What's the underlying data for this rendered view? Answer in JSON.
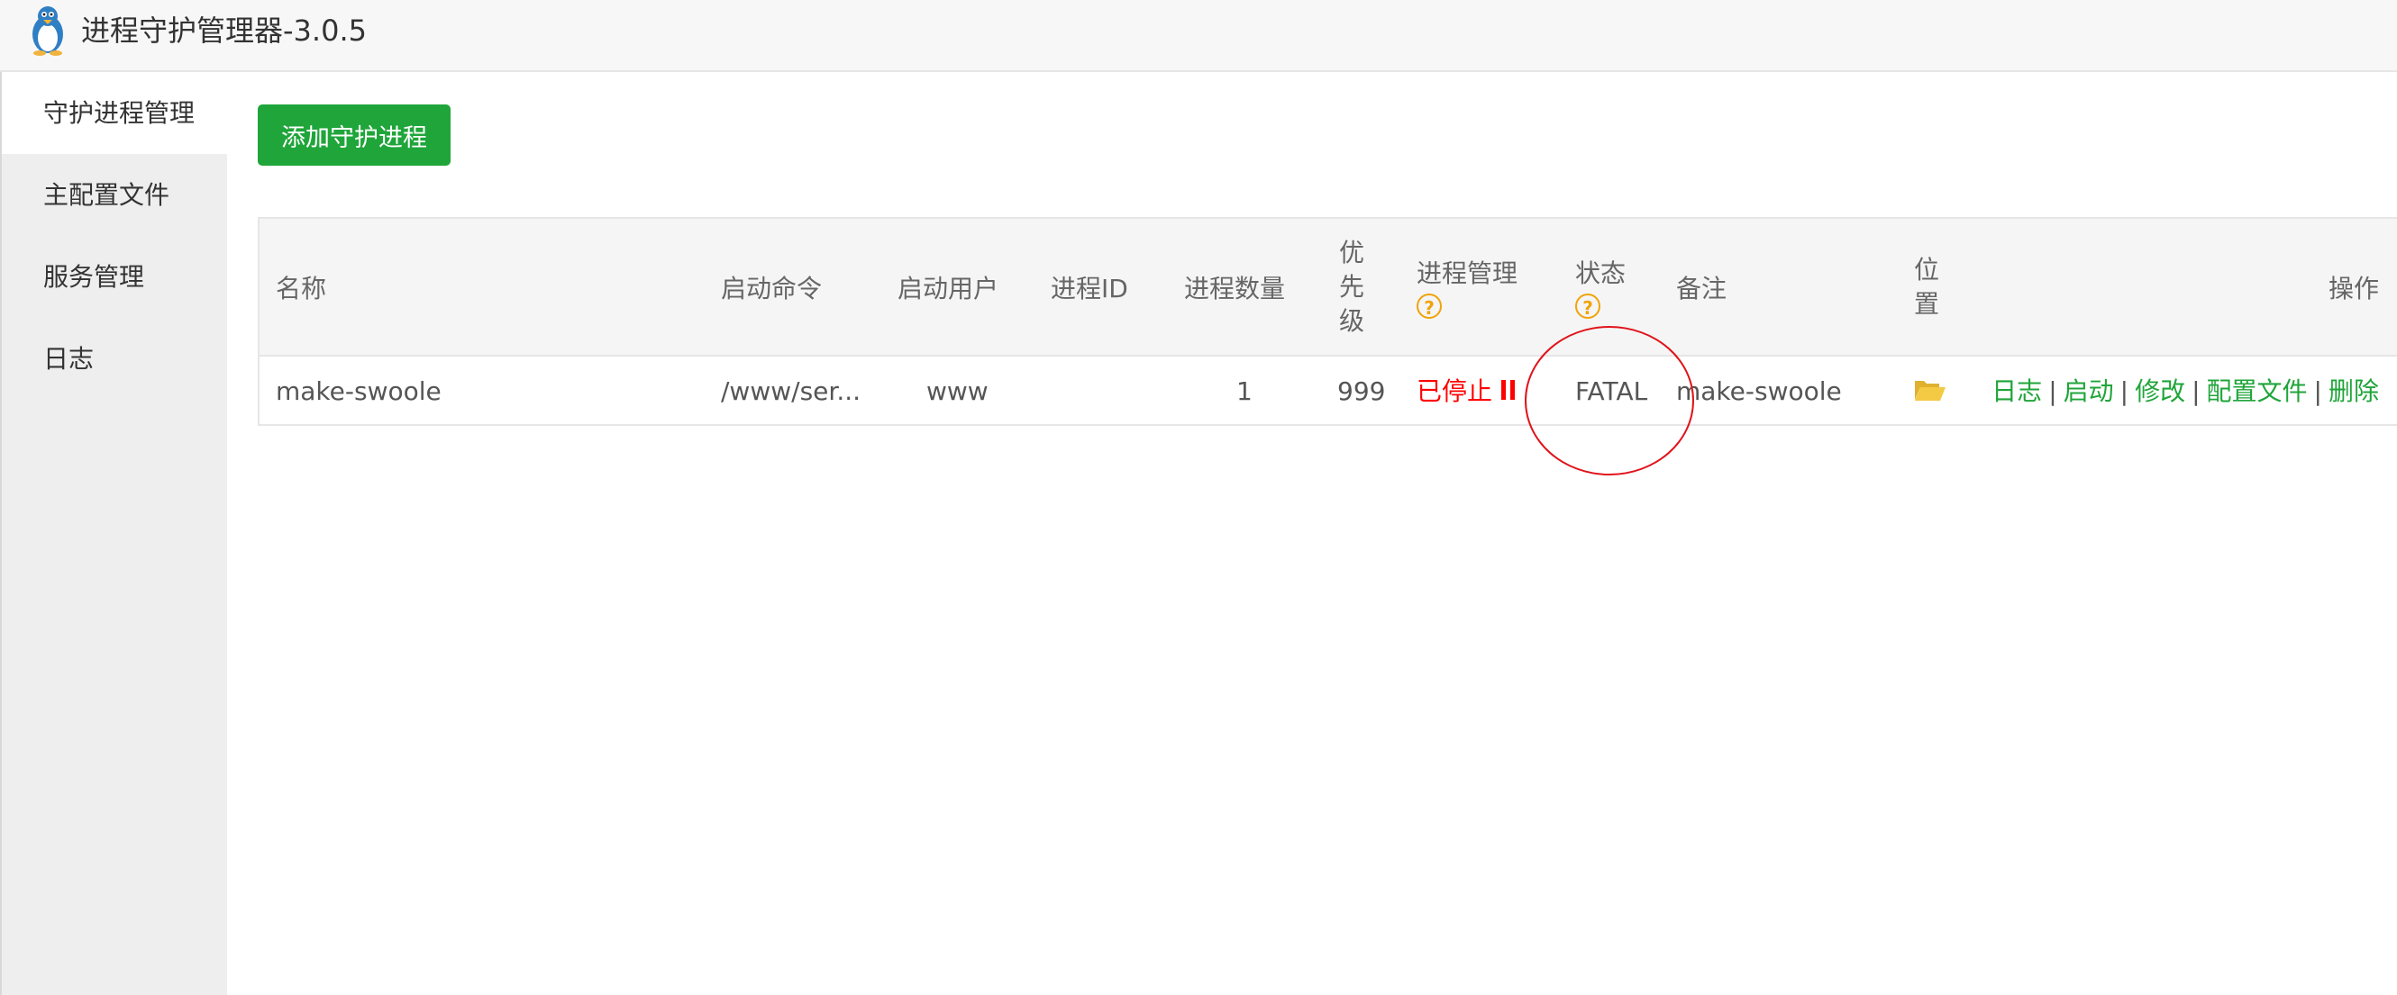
{
  "app": {
    "title": "进程守护管理器-3.0.5",
    "logo_icon": "penguin-icon"
  },
  "sidebar": {
    "items": [
      {
        "label": "守护进程管理",
        "active": true
      },
      {
        "label": "主配置文件",
        "active": false
      },
      {
        "label": "服务管理",
        "active": false
      },
      {
        "label": "日志",
        "active": false
      }
    ]
  },
  "toolbar": {
    "add_label": "添加守护进程"
  },
  "table": {
    "headers": {
      "name": "名称",
      "command": "启动命令",
      "user": "启动用户",
      "pid": "进程ID",
      "count": "进程数量",
      "priority": "优先级",
      "manage": "进程管理",
      "status": "状态",
      "remark": "备注",
      "location": "位置",
      "actions": "操作"
    },
    "rows": [
      {
        "name": "make-swoole",
        "command": "/www/ser...",
        "user": "www",
        "pid": "",
        "count": "1",
        "priority": "999",
        "manage_state": "已停止",
        "status": "FATAL",
        "remark": "make-swoole",
        "location_icon": "folder-open-icon",
        "actions": {
          "log": "日志",
          "start": "启动",
          "edit": "修改",
          "config": "配置文件",
          "delete": "删除",
          "separator": "|"
        }
      }
    ]
  },
  "icons": {
    "help": "question-circle-icon",
    "stopped": "pause-icon"
  },
  "help_glyph": "?",
  "colors": {
    "accent_green": "#20a53a",
    "stopped_red": "#ff0000",
    "help_orange": "#f0a30a",
    "folder_yellow": "#f4c944",
    "annotation_red": "#e0131a"
  }
}
